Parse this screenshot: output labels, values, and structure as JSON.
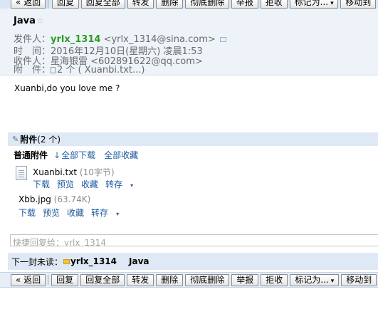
{
  "toolbar_top": {
    "back": "« 返回",
    "reply": "回复",
    "reply_all": "回复全部",
    "forward": "转发",
    "delete": "删除",
    "delete_forever": "彻底删除",
    "report": "举报",
    "reject": "拒收",
    "mark_as": "标记为...",
    "move_to": "移动到"
  },
  "header": {
    "subject": "Java",
    "star": "☆",
    "sender_label": "发件人：",
    "sender_name": "yrlx_1314",
    "sender_address": "<yrlx_1314@sina.com>",
    "time_label": "时　间：",
    "time_value": "2016年12月10日(星期六) 凌晨1:53",
    "recipient_label": "收件人：",
    "recipient_value": "星海银雷 <602891622@qq.com>",
    "attachment_label": "附　件：",
    "attachment_value": "2 个 ( Xuanbi.txt...)"
  },
  "body": {
    "text": "Xuanbi,do you love me ?"
  },
  "attachments": {
    "title": "附件",
    "count": "(2 个)",
    "normal_label": "普通附件",
    "download_all": "全部下载",
    "save_all": "全部收藏",
    "files": [
      {
        "name": "Xuanbi.txt",
        "size": "(10字节)",
        "download": "下载",
        "preview": "预览",
        "favorite": "收藏",
        "save_to": "转存"
      },
      {
        "name": "Xbb.jpg",
        "size": "(63.74K)",
        "download": "下载",
        "preview": "预览",
        "favorite": "收藏",
        "save_to": "转存"
      }
    ]
  },
  "quick_reply": {
    "placeholder": "快捷回复给：yrlx_1314"
  },
  "next_unread": {
    "label": "下一封未读：",
    "sender": "yrlx_1314",
    "subject": "Java"
  },
  "toolbar_bottom": {
    "back": "« 返回",
    "reply": "回复",
    "reply_all": "回复全部",
    "forward": "转发",
    "delete": "删除",
    "delete_forever": "彻底删除",
    "report": "举报",
    "reject": "拒收",
    "mark_as": "标记为...",
    "move_to": "移动到"
  },
  "colors": {
    "toolbar_bg": "#d9e6f5",
    "sender_green": "#2f9b27",
    "link_blue": "#1e5aa0",
    "header_bg": "#eef3f9"
  }
}
